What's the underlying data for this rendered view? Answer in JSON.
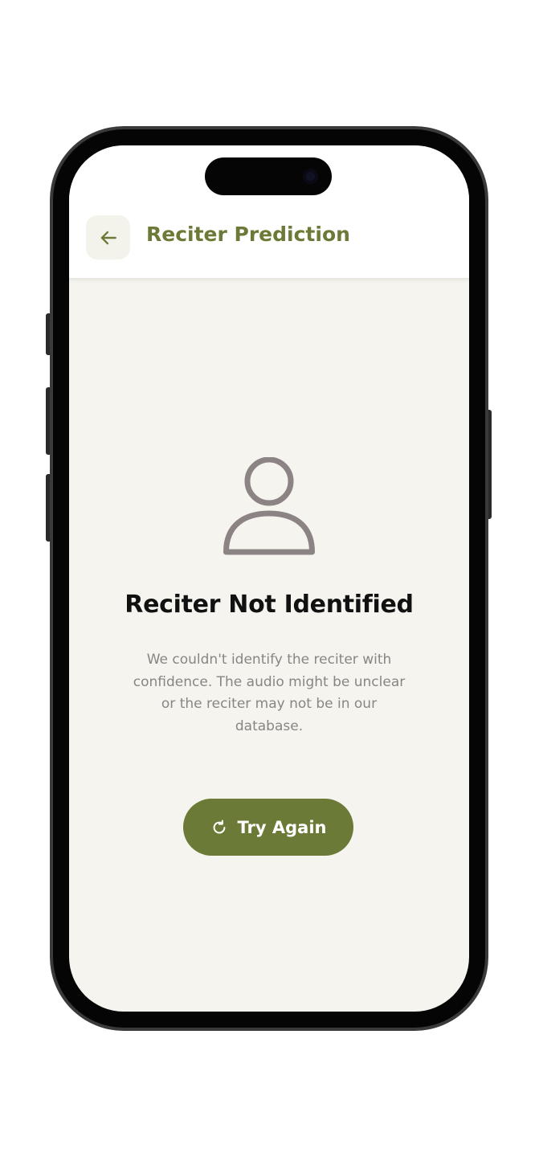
{
  "header": {
    "title": "Reciter Prediction",
    "back_icon": "arrow-left-icon"
  },
  "result": {
    "icon": "user-icon",
    "title": "Reciter Not Identified",
    "message": "We couldn't identify the reciter with confidence. The audio might be unclear or the reciter may not be in our database."
  },
  "action": {
    "label": "Try Again",
    "icon": "refresh-icon"
  },
  "colors": {
    "accent": "#6b7a36",
    "screen_background": "#f5f4ee",
    "header_background": "#ffffff",
    "message_text": "#8a8585",
    "icon_gray": "#8c8484"
  }
}
